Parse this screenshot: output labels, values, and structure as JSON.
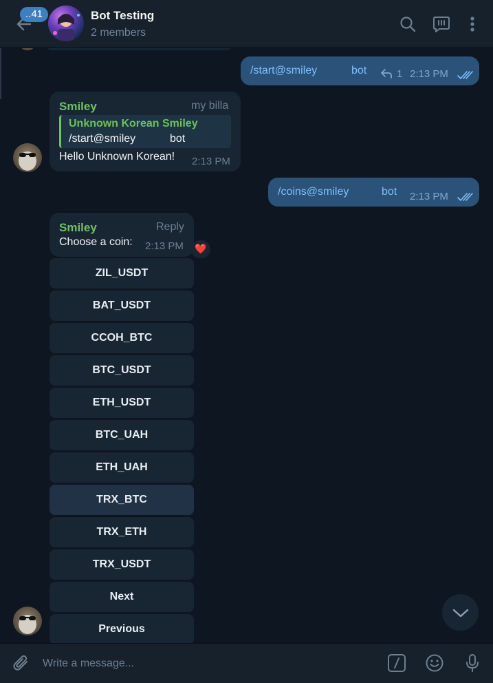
{
  "header": {
    "back_badge": "..41",
    "title": "Bot Testing",
    "subtitle": "2 members",
    "icons": [
      "back-arrow-icon",
      "search-icon",
      "bot-commands-icon",
      "more-vertical-icon"
    ]
  },
  "messages": {
    "out1": {
      "text": "/start@smiley",
      "suffix": "bot",
      "reply_count": "1",
      "time": "2:13 PM"
    },
    "in1": {
      "sender": "Smiley",
      "tag": "my billa",
      "quote_sender": "Unknown Korean Smiley",
      "quote_text": "/start@smiley",
      "quote_suffix": "bot",
      "text": "Hello Unknown Korean!",
      "time": "2:13 PM"
    },
    "out2": {
      "text": "/coins@smiley",
      "suffix": "bot",
      "time": "2:13 PM"
    },
    "in2": {
      "sender": "Smiley",
      "action": "Reply",
      "text": "Choose a coin:",
      "time": "2:13 PM",
      "reaction": "❤️"
    }
  },
  "keyboard": [
    "ZIL_USDT",
    "BAT_USDT",
    "CCOH_BTC",
    "BTC_USDT",
    "ETH_USDT",
    "BTC_UAH",
    "ETH_UAH",
    "TRX_BTC",
    "TRX_ETH",
    "TRX_USDT",
    "Next",
    "Previous"
  ],
  "composer": {
    "placeholder": "Write a message..."
  },
  "colors": {
    "background": "#0e1621",
    "panel": "#17212b",
    "incoming": "#182533",
    "outgoing": "#2b5278",
    "sender": "#6fc05e",
    "link": "#7ec0ff"
  }
}
